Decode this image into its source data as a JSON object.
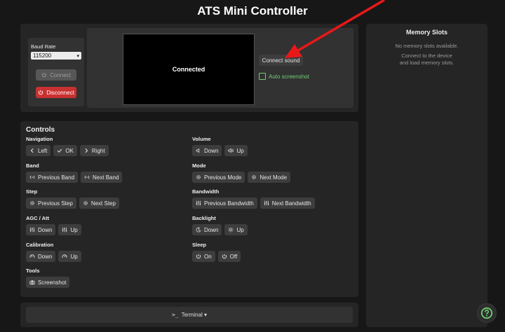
{
  "header": {
    "title": "ATS Mini Controller"
  },
  "connection": {
    "baud_label": "Baud Rate",
    "baud_value": "115200",
    "connect_label": "Connect",
    "disconnect_label": "Disconnect",
    "screen_status": "Connected",
    "connect_sound_label": "Connect sound",
    "auto_screenshot_label": "Auto screenshot"
  },
  "memory": {
    "title": "Memory Slots",
    "line1": "No memory slots available.",
    "line2": "Connect to the device",
    "line3": "and load memory slots."
  },
  "controls": {
    "title": "Controls",
    "navigation": {
      "label": "Navigation",
      "left": "Left",
      "ok": "OK",
      "right": "Right"
    },
    "volume": {
      "label": "Volume",
      "down": "Down",
      "up": "Up"
    },
    "band": {
      "label": "Band",
      "prev": "Previous Band",
      "next": "Next Band"
    },
    "mode": {
      "label": "Mode",
      "prev": "Previous Mode",
      "next": "Next Mode"
    },
    "step": {
      "label": "Step",
      "prev": "Previous Step",
      "next": "Next Step"
    },
    "bandwidth": {
      "label": "Bandwidth",
      "prev": "Previous Bandwidth",
      "next": "Next Bandwidth"
    },
    "agc": {
      "label": "AGC / Att",
      "down": "Down",
      "up": "Up"
    },
    "backlight": {
      "label": "Backlight",
      "down": "Down",
      "up": "Up"
    },
    "calibration": {
      "label": "Calibration",
      "down": "Down",
      "up": "Up"
    },
    "sleep": {
      "label": "Sleep",
      "on": "On",
      "off": "Off"
    },
    "tools": {
      "label": "Tools",
      "screenshot": "Screenshot"
    }
  },
  "terminal": {
    "label": "Terminal ▾"
  },
  "colors": {
    "accent_green": "#6fcf73",
    "danger_red": "#c93030",
    "annotation_red": "#e81818"
  }
}
